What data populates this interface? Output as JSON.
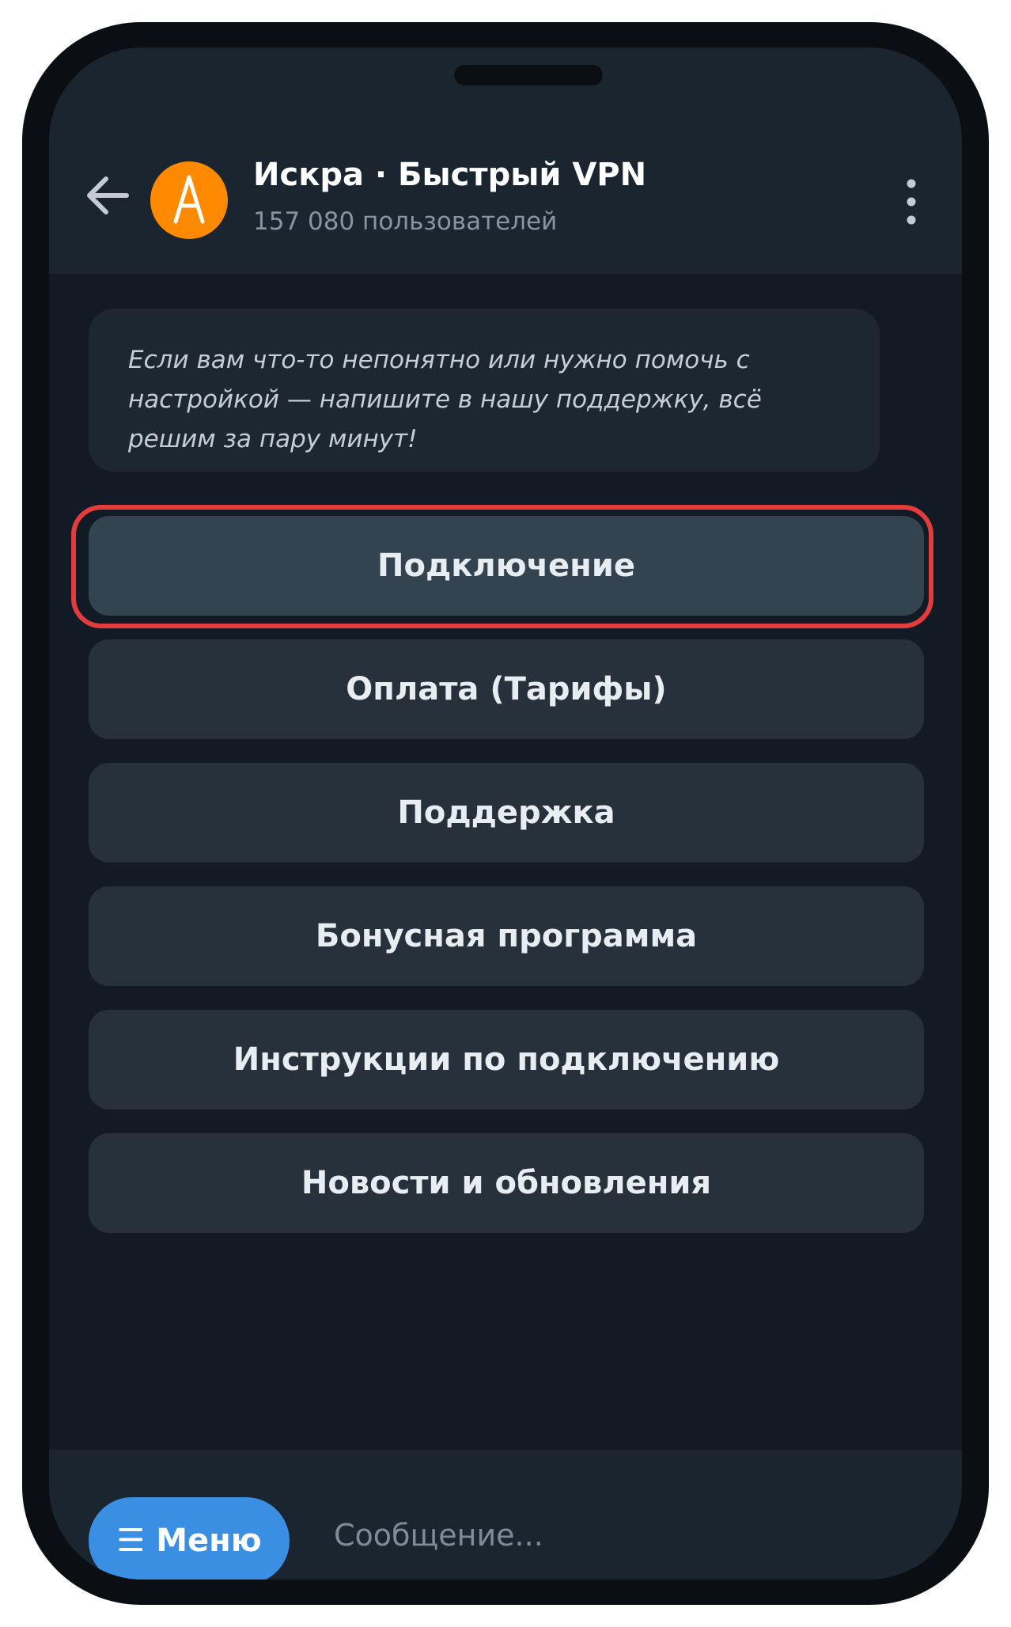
{
  "header": {
    "avatar_letter": "A",
    "title": "Искра · Быстрый VPN",
    "subtitle": "157 080 пользователей"
  },
  "message": {
    "text": "Если вам что-то непонятно или нужно помочь с настройкой — напишите в нашу поддержку, всё решим за пару минут!"
  },
  "buttons": [
    {
      "label": "Подключение",
      "highlighted": true
    },
    {
      "label": "Оплата (Тарифы)",
      "highlighted": false
    },
    {
      "label": "Поддержка",
      "highlighted": false
    },
    {
      "label": "Бонусная программа",
      "highlighted": false
    },
    {
      "label": "Инструкции по подключению",
      "highlighted": false
    },
    {
      "label": "Новости и обновления",
      "highlighted": false
    }
  ],
  "input": {
    "menu_label": "Меню",
    "placeholder": "Сообщение..."
  },
  "colors": {
    "accent": "#3a8fe3",
    "avatar": "#ff8a00",
    "highlight": "#e23c3c",
    "background": "#121b25"
  }
}
